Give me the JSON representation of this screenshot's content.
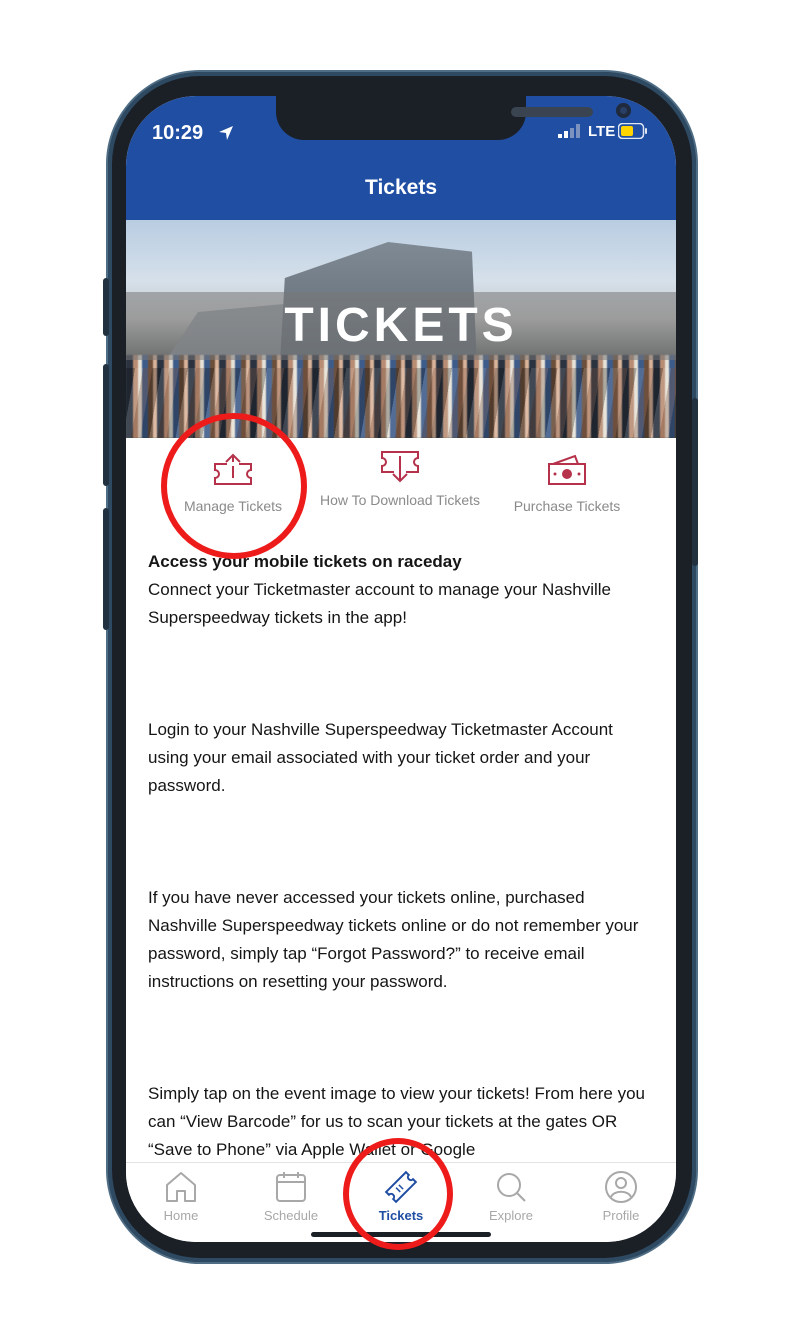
{
  "status_bar": {
    "time": "10:29",
    "network": "LTE"
  },
  "header": {
    "title": "Tickets"
  },
  "banner": {
    "text": "TICKETS"
  },
  "actions": [
    {
      "label": "Manage Tickets",
      "icon": "ticket-upload-icon"
    },
    {
      "label": "How To Download Tickets",
      "icon": "ticket-download-icon"
    },
    {
      "label": "Purchase Tickets",
      "icon": "money-icon"
    }
  ],
  "content": {
    "heading": "Access your mobile tickets on raceday",
    "p1": "Connect your Ticketmaster account to manage your Nashville Superspeedway tickets in the app!",
    "p2": "Login to your Nashville Superspeedway Ticketmaster Account using your email associated with your ticket order and your password.",
    "p3": "If you have never accessed your tickets online, purchased Nashville Superspeedway tickets online or do not remember your password, simply tap “Forgot Password?” to receive email instructions on resetting your password.",
    "p4": "Simply tap on the event image to view your tickets! From here you can “View Barcode” for us to scan your tickets at the gates OR “Save to Phone” via Apple Wallet or Google"
  },
  "tabs": [
    {
      "label": "Home",
      "icon": "home-icon"
    },
    {
      "label": "Schedule",
      "icon": "calendar-icon"
    },
    {
      "label": "Tickets",
      "icon": "ticket-icon",
      "active": true
    },
    {
      "label": "Explore",
      "icon": "search-icon"
    },
    {
      "label": "Profile",
      "icon": "profile-icon"
    }
  ],
  "colors": {
    "header": "#1f4ea3",
    "action_icon": "#b5324a",
    "annotation": "#ee1b1b",
    "battery": "#ffd400"
  }
}
